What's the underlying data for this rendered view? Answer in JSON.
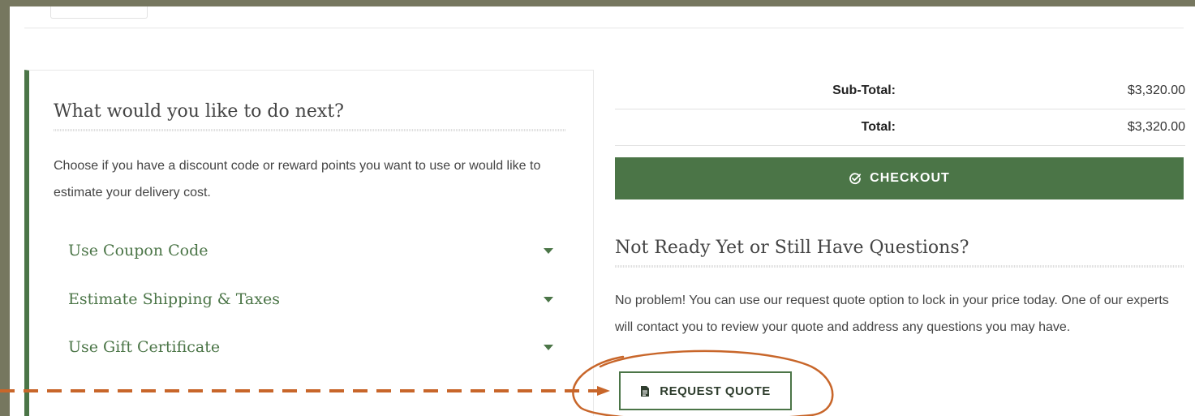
{
  "panel": {
    "title": "What would you like to do next?",
    "description": "Choose if you have a discount code or reward points you want to use or would like to estimate your delivery cost.",
    "items": [
      {
        "label": "Use Coupon Code"
      },
      {
        "label": "Estimate Shipping & Taxes"
      },
      {
        "label": "Use Gift Certificate"
      }
    ]
  },
  "totals": {
    "subtotal_label": "Sub-Total:",
    "subtotal_value": "$3,320.00",
    "total_label": "Total:",
    "total_value": "$3,320.00"
  },
  "checkout": {
    "label": "CHECKOUT",
    "icon": "check-circle-icon"
  },
  "questions": {
    "title": "Not Ready Yet or Still Have Questions?",
    "description": "No problem! You can use our request quote option to lock in your price today. One of our experts will contact you to review your quote and address any questions you may have."
  },
  "request_quote": {
    "label": "REQUEST QUOTE",
    "icon": "document-icon"
  },
  "annotation": {
    "arrow_color": "#c8662a",
    "circle_color": "#c8662a"
  },
  "colors": {
    "brand_green": "#4b7547",
    "background": "#76775f"
  }
}
